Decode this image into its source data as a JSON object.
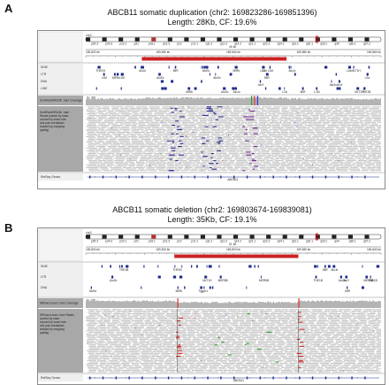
{
  "panels": [
    {
      "letter": "A",
      "caption_title": "ABCB11 somatic duplication (chr2: 169823286-169851396)",
      "caption_sub": "Length: 28Kb, CF: 19.6%",
      "chrom": "chr2",
      "span_label": "45 kb",
      "ruler_ticks": [
        "169,820 kb",
        "169,830 kb",
        "169,840 kb",
        "169,850 kb",
        "169,860 kb"
      ],
      "ideogram_bands": [
        "p25.3",
        "p24.3",
        "p23.1",
        "p21",
        "p16.1",
        "p13.3",
        "p12",
        "p11.1",
        "q11.2",
        "q12.3",
        "q14.2",
        "q21.1",
        "q22.2",
        "q24.1",
        "q31.1",
        "q32.1",
        "q33.1",
        "q34",
        "q36.1",
        "q37.2"
      ],
      "track_labels": [
        "SINE",
        "LTR",
        "DNA",
        "LINE"
      ],
      "coverage_label": "SomRes4H9h16h .bam Coverage",
      "coverage_range": "[0 - 95]",
      "reads_label": "SomRes4H9h16h .bam Reads (sorted by base; colored by insert size and pair orientation; shaded by mapping quality)",
      "refseq_label": "RefSeq Genes",
      "gene_name": "ABCB11"
    },
    {
      "letter": "B",
      "caption_title": "ABCB11 somatic deletion (chr2: 169803674-169839081)",
      "caption_sub": "Length: 35Kb, CF: 19.1%",
      "chrom": "chr2",
      "span_label": "51 kb",
      "ruler_ticks": [
        "169,800 kb",
        "169,810 kb",
        "169,820 kb",
        "169,830 kb",
        "169,840 kb"
      ],
      "ideogram_bands": [
        "p25.3",
        "p24.3",
        "p23.1",
        "p21",
        "p16.1",
        "p13.3",
        "p12",
        "p11.1",
        "q11.2",
        "q12.3",
        "q14.2",
        "q21.1",
        "q22.2",
        "q24.1",
        "q31.1",
        "q32.1",
        "q33.1",
        "q34",
        "q36.1",
        "q37.2"
      ],
      "track_labels": [
        "SINE",
        "LTR",
        "DNA"
      ],
      "coverage_label": "SRNonco.bam .bam Coverage",
      "coverage_range": "[0 - 95]",
      "reads_label": "SRNonco.bam .bam Reads (sorted by base; colored by insert size and pair orientation; shaded by mapping quality)",
      "refseq_label": "RefSeq Genes",
      "gene_name": "ABCB11"
    }
  ],
  "colors": {
    "highlight_red": "#cc2222",
    "coverage_gray": "#b4b4b4",
    "read_gray": "#c8c8c8",
    "refseq_blue": "#1a2c8c",
    "label_panel_bg": "#efefef",
    "dark_label_bg": "#a8a8a8"
  }
}
